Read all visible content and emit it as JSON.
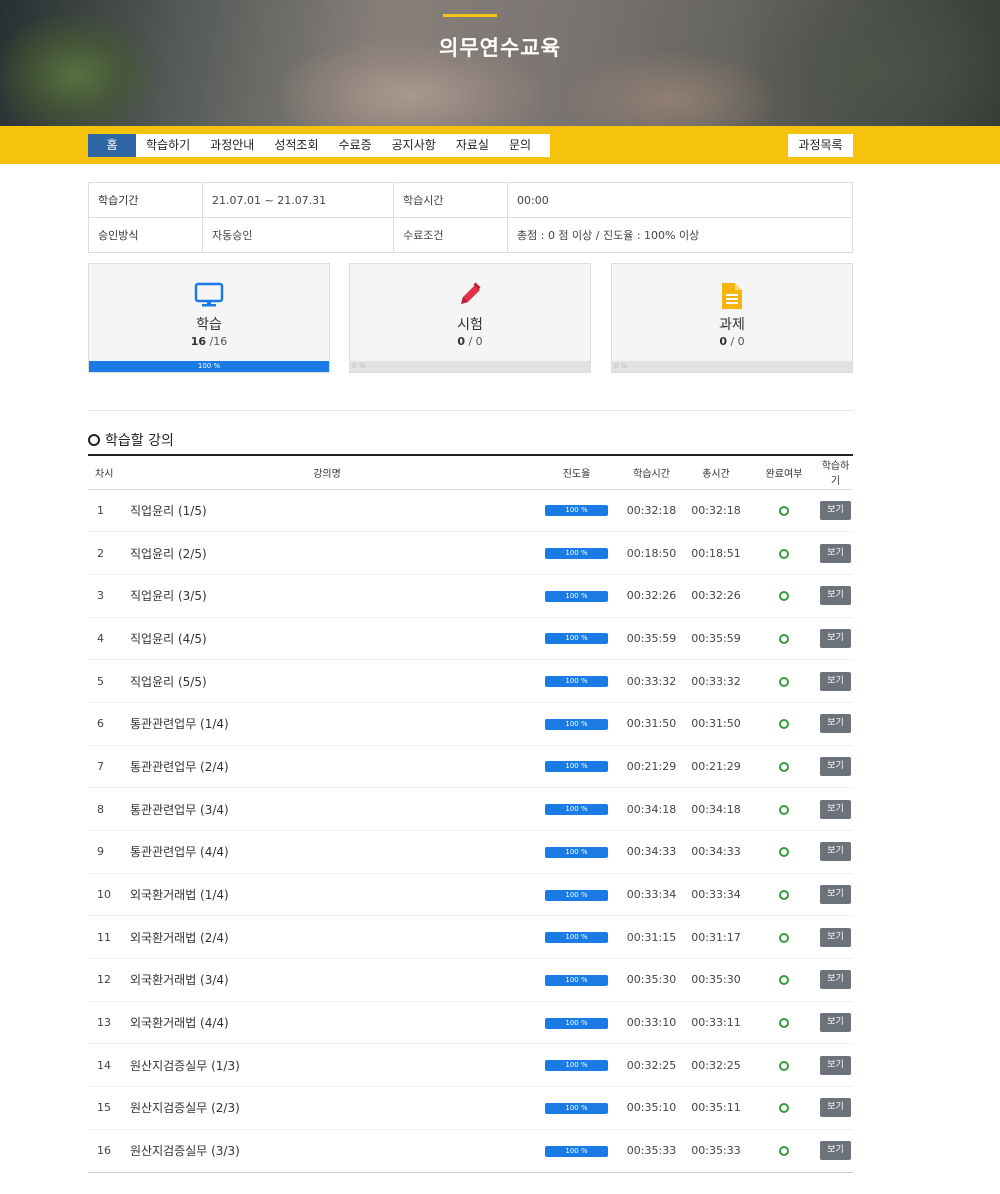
{
  "hero": {
    "title": "의무연수교육"
  },
  "nav": {
    "items": [
      "홈",
      "학습하기",
      "과정안내",
      "성적조회",
      "수료증",
      "공지사항",
      "자료실",
      "문의"
    ],
    "active": "홈",
    "course_list_label": "과정목록"
  },
  "info": {
    "period_label": "학습기간",
    "period_value": "21.07.01 ~ 21.07.31",
    "time_label": "학습시간",
    "time_value": "00:00",
    "approval_label": "승인방식",
    "approval_value": "자동승인",
    "criteria_label": "수료조건",
    "criteria_value": "총점 : 0 점 이상 / 진도율 : 100% 이상"
  },
  "cards": [
    {
      "label": "학습",
      "done": "16",
      "total": " /16",
      "progress": 100,
      "pct_label": "100 %",
      "icon": "monitor-icon"
    },
    {
      "label": "시험",
      "done": "0",
      "total": " / 0",
      "progress": 0,
      "pct_label": "0 %",
      "icon": "pencil-icon"
    },
    {
      "label": "과제",
      "done": "0",
      "total": " / 0",
      "progress": 0,
      "pct_label": "0 %",
      "icon": "document-icon"
    }
  ],
  "section_title": "학습할 강의",
  "table": {
    "headers": [
      "차시",
      "강의명",
      "진도율",
      "학습시간",
      "총시간",
      "완료여부",
      "학습하기"
    ],
    "view_label": "보기",
    "rows": [
      {
        "no": "1",
        "name": "직업윤리 (1/5)",
        "progress": "100 %",
        "study": "00:32:18",
        "total": "00:32:18"
      },
      {
        "no": "2",
        "name": "직업윤리 (2/5)",
        "progress": "100 %",
        "study": "00:18:50",
        "total": "00:18:51"
      },
      {
        "no": "3",
        "name": "직업윤리 (3/5)",
        "progress": "100 %",
        "study": "00:32:26",
        "total": "00:32:26"
      },
      {
        "no": "4",
        "name": "직업윤리 (4/5)",
        "progress": "100 %",
        "study": "00:35:59",
        "total": "00:35:59"
      },
      {
        "no": "5",
        "name": "직업윤리 (5/5)",
        "progress": "100 %",
        "study": "00:33:32",
        "total": "00:33:32"
      },
      {
        "no": "6",
        "name": "통관관련업무 (1/4)",
        "progress": "100 %",
        "study": "00:31:50",
        "total": "00:31:50"
      },
      {
        "no": "7",
        "name": "통관관련업무 (2/4)",
        "progress": "100 %",
        "study": "00:21:29",
        "total": "00:21:29"
      },
      {
        "no": "8",
        "name": "통관관련업무 (3/4)",
        "progress": "100 %",
        "study": "00:34:18",
        "total": "00:34:18"
      },
      {
        "no": "9",
        "name": "통관관련업무 (4/4)",
        "progress": "100 %",
        "study": "00:34:33",
        "total": "00:34:33"
      },
      {
        "no": "10",
        "name": "외국환거래법 (1/4)",
        "progress": "100 %",
        "study": "00:33:34",
        "total": "00:33:34"
      },
      {
        "no": "11",
        "name": "외국환거래법 (2/4)",
        "progress": "100 %",
        "study": "00:31:15",
        "total": "00:31:17"
      },
      {
        "no": "12",
        "name": "외국환거래법 (3/4)",
        "progress": "100 %",
        "study": "00:35:30",
        "total": "00:35:30"
      },
      {
        "no": "13",
        "name": "외국환거래법 (4/4)",
        "progress": "100 %",
        "study": "00:33:10",
        "total": "00:33:11"
      },
      {
        "no": "14",
        "name": "원산지검증실무 (1/3)",
        "progress": "100 %",
        "study": "00:32:25",
        "total": "00:32:25"
      },
      {
        "no": "15",
        "name": "원산지검증실무 (2/3)",
        "progress": "100 %",
        "study": "00:35:10",
        "total": "00:35:11"
      },
      {
        "no": "16",
        "name": "원산지검증실무 (3/3)",
        "progress": "100 %",
        "study": "00:35:33",
        "total": "00:35:33"
      }
    ]
  },
  "colors": {
    "accent_yellow": "#f5c20c",
    "nav_active": "#2f67a4",
    "progress_blue": "#1a7be6",
    "complete_green": "#3a9a3a",
    "button_gray": "#6c727a"
  }
}
